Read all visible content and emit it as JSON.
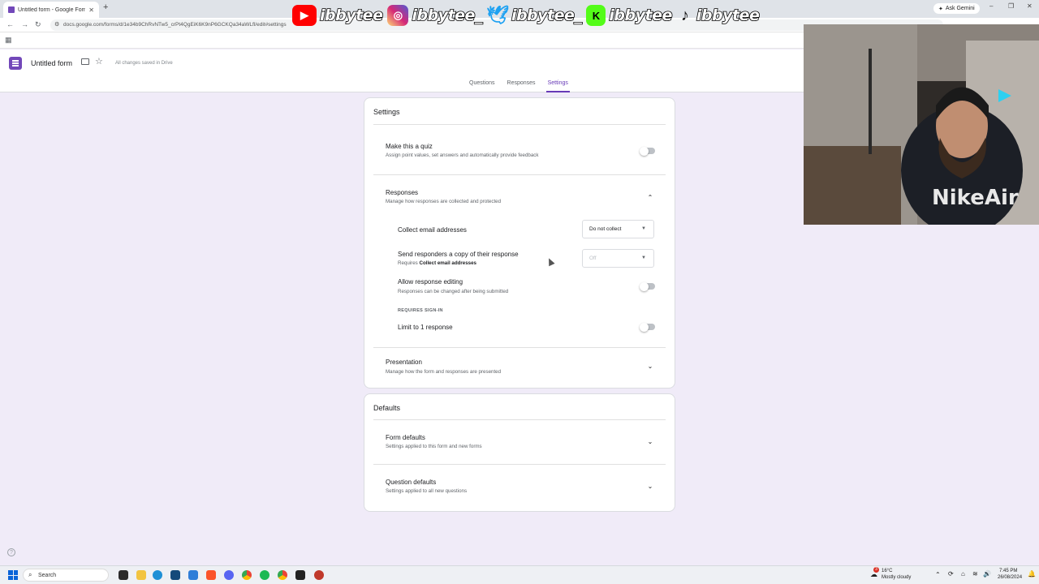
{
  "browser": {
    "tab_title": "Untitled form - Google Forms",
    "tab_close": "✕",
    "new_tab": "+",
    "url": "docs.google.com/forms/d/1e34b9ChRvNTw5_crPt4QgEiK6K9nP6GCKQa34aWLfl/edit#settings",
    "ask_gemini": "Ask Gemini",
    "win_min": "–",
    "win_max": "❐",
    "win_close": "✕"
  },
  "overlay": {
    "handles": [
      {
        "icon": "youtube-icon",
        "name": "ibbytee"
      },
      {
        "icon": "instagram-icon",
        "name": "ibbytee_"
      },
      {
        "icon": "twitter-icon",
        "name": "ibbytee_"
      },
      {
        "icon": "kick-icon",
        "name": "ibbytee"
      },
      {
        "icon": "tiktok-icon",
        "name": "ibbytee"
      }
    ],
    "colors": {
      "youtube": "#ff0000",
      "instagram": "#d6249f",
      "twitter": "#1da1f2",
      "kick": "#53fc18",
      "tiktok": "#111111"
    }
  },
  "form": {
    "title": "Untitled form",
    "saved_status": "All changes saved in Drive",
    "tabs": [
      "Questions",
      "Responses",
      "Settings"
    ],
    "active_tab": "Settings",
    "accent": "#673ab7"
  },
  "settings_card": {
    "title": "Settings",
    "quiz": {
      "title": "Make this a quiz",
      "subtitle": "Assign point values, set answers and automatically provide feedback"
    },
    "responses": {
      "title": "Responses",
      "subtitle": "Manage how responses are collected and protected",
      "collect_email": {
        "label": "Collect email addresses",
        "value": "Do not collect"
      },
      "send_copy": {
        "label": "Send responders a copy of their response",
        "requires_prefix": "Requires",
        "requires_bold": "Collect email addresses",
        "value": "Off"
      },
      "allow_editing": {
        "label": "Allow response editing",
        "subtitle": "Responses can be changed after being submitted"
      },
      "requires_signin": "REQUIRES SIGN-IN",
      "limit_one": {
        "label": "Limit to 1 response"
      }
    },
    "presentation": {
      "title": "Presentation",
      "subtitle": "Manage how the form and responses are presented"
    }
  },
  "defaults_card": {
    "title": "Defaults",
    "form_defaults": {
      "title": "Form defaults",
      "subtitle": "Settings applied to this form and new forms"
    },
    "question_defaults": {
      "title": "Question defaults",
      "subtitle": "Settings applied to all new questions"
    }
  },
  "taskbar": {
    "search_placeholder": "Search",
    "weather_temp": "16°C",
    "weather_desc": "Mostly cloudy",
    "weather_badge": "3",
    "time": "7:45 PM",
    "date": "26/08/2024"
  }
}
